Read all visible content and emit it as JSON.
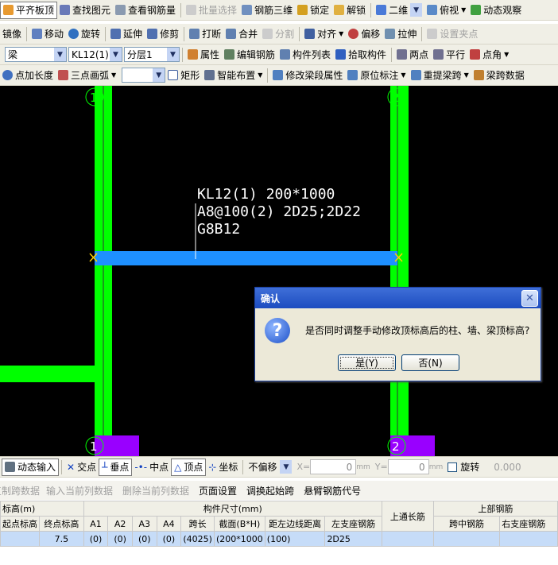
{
  "toolbar1": {
    "flat_top": "平齐板顶",
    "find": "查找图元",
    "view_rebar": "查看钢筋量",
    "batch": "批量选择",
    "rebar3d": "钢筋三维",
    "lock": "锁定",
    "unlock": "解锁",
    "view2d": "二维",
    "topview": "俯视",
    "dynamic": "动态观察"
  },
  "toolbar2": {
    "mirror": "镜像",
    "move": "移动",
    "rotate": "旋转",
    "extend": "延伸",
    "trim": "修剪",
    "break": "打断",
    "merge": "合并",
    "split": "分割",
    "align": "对齐",
    "offset": "偏移",
    "stretch": "拉伸",
    "grip": "设置夹点"
  },
  "toolbar3": {
    "type": "梁",
    "name": "KL12(1)",
    "layer": "分层1",
    "prop": "属性",
    "edit_rebar": "编辑钢筋",
    "list": "构件列表",
    "pick": "拾取构件",
    "twopoint": "两点",
    "parallel": "平行",
    "angle": "点角"
  },
  "toolbar4": {
    "addlen": "点加长度",
    "arc": "三点画弧",
    "empty": "",
    "rect": "矩形",
    "smart": "智能布置",
    "modspan": "修改梁段属性",
    "origin": "原位标注",
    "reextract": "重提梁跨",
    "spandata": "梁跨数据"
  },
  "canvas": {
    "axis1": "1",
    "axis2": "2",
    "label1": "KL12(1) 200*1000",
    "label2": "A8@100(2) 2D25;2D22",
    "label3": "G8B12"
  },
  "dialog": {
    "title": "确认",
    "message": "是否同时调整手动修改顶标高后的柱、墙、梁顶标高?",
    "yes": "是(Y)",
    "no": "否(N)"
  },
  "statusbar": {
    "dyn_input": "动态输入",
    "intersect": "交点",
    "perp": "垂点",
    "mid": "中点",
    "vertex": "顶点",
    "coord": "坐标",
    "nomove": "不偏移",
    "x_label": "X=",
    "x_val": "0",
    "y_label": "Y=",
    "y_val": "0",
    "unit": "mm",
    "rotate": "旋转",
    "rot_val": "0.000"
  },
  "tabbar": {
    "paste": "复制跨数据",
    "input": "输入当前列数据",
    "del": "删除当前列数据",
    "page": "页面设置",
    "swap": "调换起始跨",
    "cant": "悬臂钢筋代号"
  },
  "table": {
    "h_elev": "标高(m)",
    "h_size": "构件尺寸(mm)",
    "h_through": "上通长筋",
    "h_top": "上部钢筋",
    "h_start": "起点标高",
    "h_end": "终点标高",
    "h_a1": "A1",
    "h_a2": "A2",
    "h_a3": "A3",
    "h_a4": "A4",
    "h_span": "跨长",
    "h_section": "截面(B*H)",
    "h_dist": "距左边线距离",
    "h_left": "左支座钢筋",
    "h_mid": "跨中钢筋",
    "h_right": "右支座钢筋",
    "row": {
      "start": "",
      "end": "7.5",
      "a1": "(0)",
      "a2": "(0)",
      "a3": "(0)",
      "a4": "(0)",
      "span": "(4025)",
      "section": "(200*1000",
      "dist": "(100)",
      "through": "2D25",
      "left": "",
      "mid": "",
      "right": ""
    }
  }
}
